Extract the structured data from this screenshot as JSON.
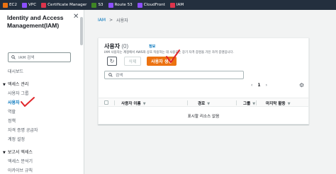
{
  "topbar": {
    "services": [
      {
        "label": "EC2",
        "color": "#ec7211"
      },
      {
        "label": "VPC",
        "color": "#8c4fff"
      },
      {
        "label": "Certificate Manager",
        "color": "#dd344c"
      },
      {
        "label": "S3",
        "color": "#3f8624"
      },
      {
        "label": "Route 53",
        "color": "#8c4fff"
      },
      {
        "label": "CloudFront",
        "color": "#8c4fff"
      },
      {
        "label": "IAM",
        "color": "#dd344c"
      }
    ]
  },
  "sidebar": {
    "title": "Identity and Access Management(IAM)",
    "search_placeholder": "IAM 검색",
    "dashboard": "대시보드",
    "access_management": {
      "label": "액세스 관리",
      "items": [
        "사용자 그룹",
        "사용자",
        "역할",
        "정책",
        "자격 증명 공급자",
        "계정 설정"
      ],
      "active_index": 1
    },
    "access_reports": {
      "label": "보고서 액세스",
      "items": [
        "액세스 분석기",
        "아카이브 규칙"
      ]
    }
  },
  "breadcrumb": {
    "root": "IAM",
    "current": "사용자"
  },
  "users_panel": {
    "title": "사용자",
    "count": "(0)",
    "info": "정보",
    "description": "IAM 사용자는 계정에서 AWS와 상호 작용하는 데 사용되는 장기 자격 증명을 가진 자격 증명입니다.",
    "delete_label": "삭제",
    "create_label": "사용자 생성",
    "search_placeholder": "검색",
    "page_number": "1",
    "columns": [
      "사용자 이름",
      "경로",
      "그룹",
      "마지막 활동"
    ],
    "empty_text": "표시할 리소스 없음"
  },
  "colors": {
    "accent": "#ec7211",
    "link": "#0073bb",
    "annotation": "#e0262b"
  }
}
